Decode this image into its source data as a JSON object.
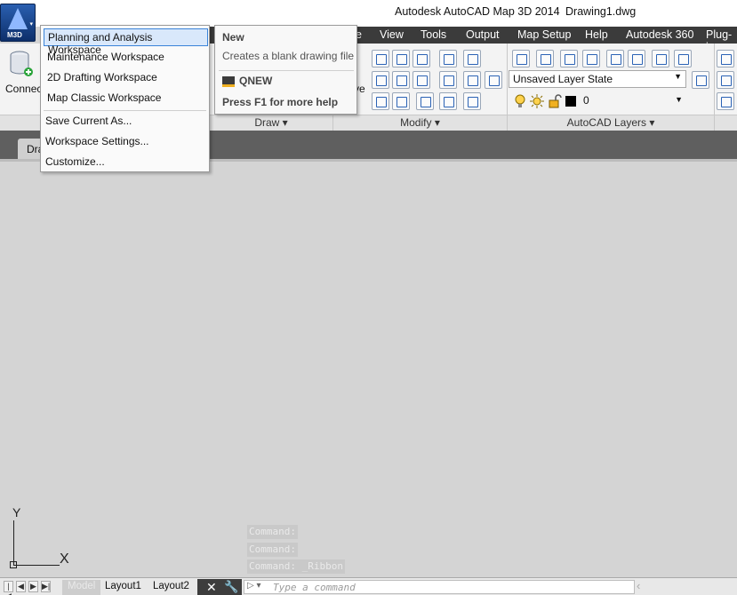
{
  "window": {
    "app_title": "Autodesk AutoCAD Map 3D 2014",
    "document_title": "Drawing1.dwg"
  },
  "app_button": {
    "badge": "M3D",
    "caret": "▾"
  },
  "menubar": {
    "items": [
      "e",
      "View",
      "Tools",
      "Output",
      "Map Setup",
      "Help",
      "Autodesk 360",
      "Plug-in"
    ]
  },
  "ribbon": {
    "connect_label": "Connec",
    "panels": [
      "Draw ▾",
      "Modify ▾",
      "AutoCAD Layers ▾"
    ],
    "layer_state": "Unsaved Layer State",
    "current_layer": "0",
    "layer_color": "#000000",
    "fragment_ve": "ve"
  },
  "tabs": {
    "document_tab": "Dra"
  },
  "workspace_menu": {
    "items": [
      "Planning and Analysis Workspace",
      "Maintenance Workspace",
      "2D Drafting Workspace",
      "Map Classic Workspace",
      "Save Current As...",
      "Workspace Settings...",
      "Customize..."
    ]
  },
  "tooltip": {
    "title": "New",
    "description": "Creates a blank drawing file",
    "command": "QNEW",
    "help": "Press F1 for more help"
  },
  "ucs": {
    "y": "Y",
    "x": "X"
  },
  "command_history": [
    "Command:",
    "Command:",
    "Command:  _Ribbon"
  ],
  "bottom": {
    "tabs": [
      "Model",
      "Layout1",
      "Layout2"
    ],
    "command_placeholder": "Type a command"
  }
}
